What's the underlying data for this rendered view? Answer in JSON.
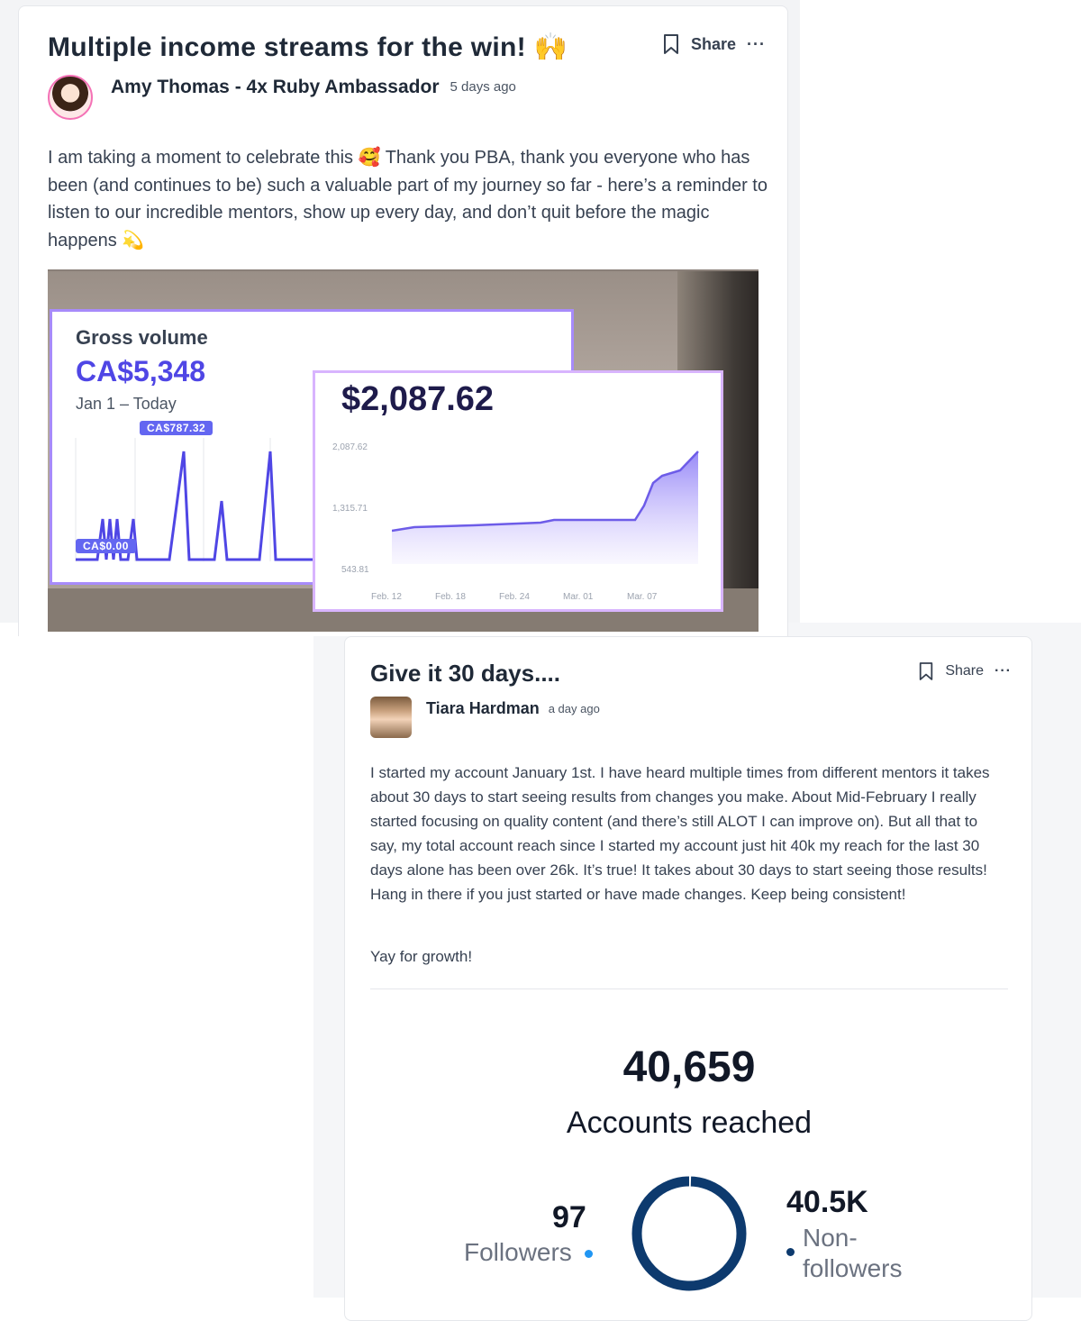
{
  "post1": {
    "title": "Multiple income streams for the win! 🙌",
    "author": "Amy Thomas - 4x Ruby Ambassador",
    "time": "5 days ago",
    "share_label": "Share",
    "more_label": "···",
    "body": "I am taking a moment to celebrate this 🥰 Thank you PBA, thank you everyone who has been (and continues to be) such a valuable part of my journey so far - here’s a reminder to listen to our incredible mentors, show up every day, and don’t quit before the magic happens 💫",
    "image": {
      "panel_a": {
        "label": "Gross volume",
        "value": "CA$5,348",
        "range": "Jan 1 – Today",
        "peak_tag": "CA$787.32",
        "zero_tag": "CA$0.00"
      },
      "panel_b": {
        "value": "$2,087.62",
        "y_ticks": [
          "2,087.62",
          "1,315.71",
          "543.81"
        ],
        "x_ticks": [
          "Feb. 12",
          "Feb. 18",
          "Feb. 24",
          "Mar. 01",
          "Mar. 07"
        ]
      }
    }
  },
  "post2": {
    "title": "Give it 30 days....",
    "author": "Tiara Hardman",
    "time": "a day ago",
    "share_label": "Share",
    "more_label": "···",
    "body": "I started my account January 1st. I have heard multiple times from different mentors it takes about 30 days to start seeing results from changes you make. About Mid-February I really started focusing on quality content (and there’s still ALOT I can improve on). But all that to say, my total account reach since I started my account just hit 40k  my reach for the last 30 days alone has been over 26k. It’s true! It takes about 30 days to start seeing those results! Hang in there if you just started or have made changes. Keep being consistent!",
    "closing": "Yay for growth!",
    "stats": {
      "reached_value": "40,659",
      "reached_label": "Accounts reached",
      "followers_value": "97",
      "followers_label": "Followers",
      "nonfollowers_value": "40.5K",
      "nonfollowers_label": "Non-followers",
      "followers_share": 0.0024,
      "followers_color": "#2196f3",
      "nonfollowers_color": "#0d3a6e"
    }
  }
}
